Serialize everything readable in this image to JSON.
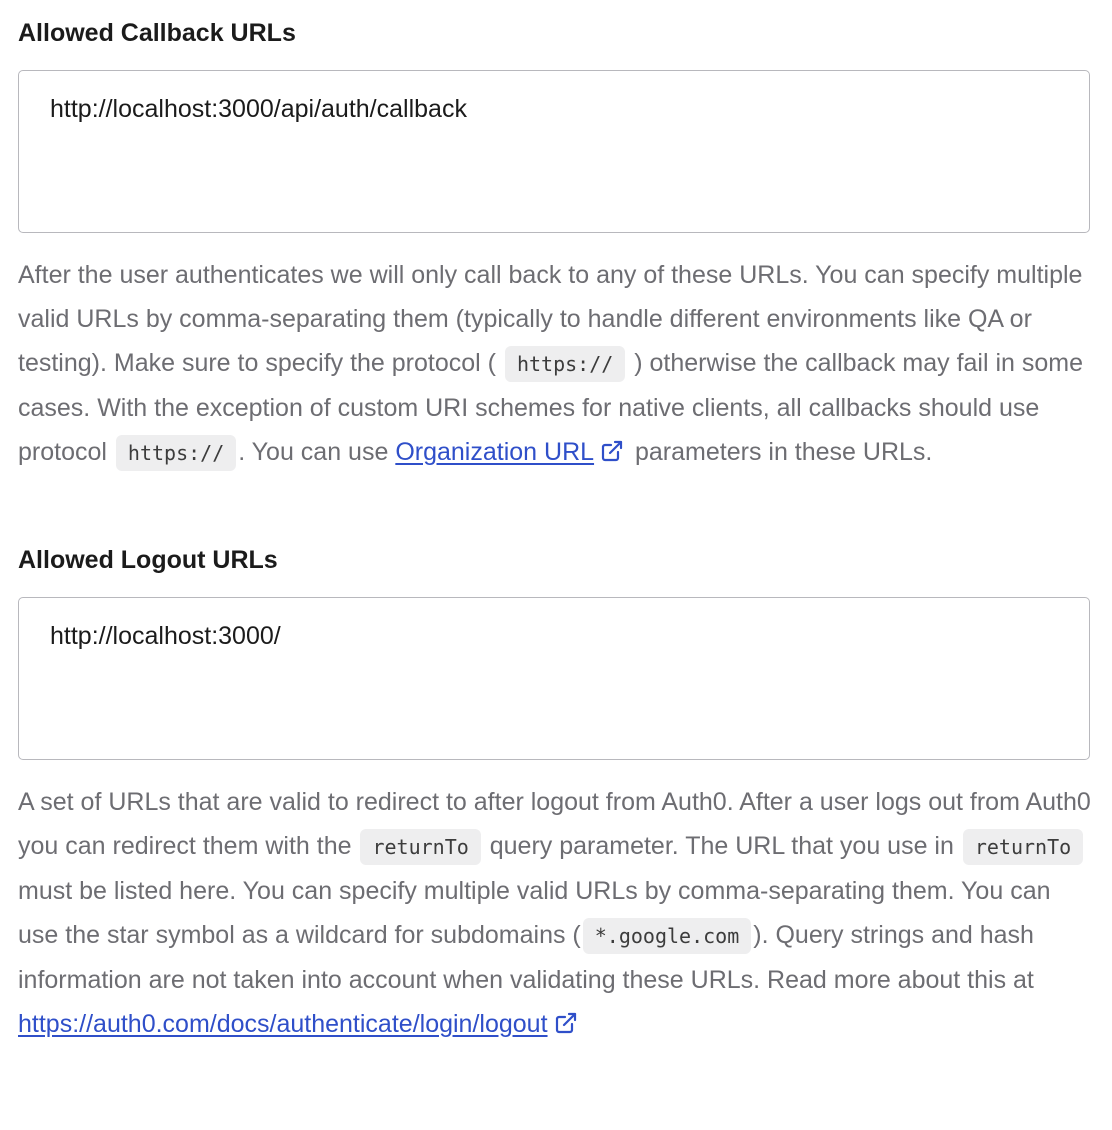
{
  "callback": {
    "label": "Allowed Callback URLs",
    "value": "http://localhost:3000/api/auth/callback",
    "help_1": "After the user authenticates we will only call back to any of these URLs. You can specify multiple valid URLs by comma-separating them (typically to handle different environments like QA or testing). Make sure to specify the protocol (",
    "code_1": "https://",
    "help_2": ") otherwise the callback may fail in some cases. With the exception of custom URI schemes for native clients, all callbacks should use protocol",
    "code_2": "https://",
    "help_3": ". You can use",
    "link_label": "Organization URL",
    "help_4": "parameters in these URLs."
  },
  "logout": {
    "label": "Allowed Logout URLs",
    "value": "http://localhost:3000/",
    "help_1": "A set of URLs that are valid to redirect to after logout from Auth0. After a user logs out from Auth0 you can redirect them with the",
    "code_1": "returnTo",
    "help_2": "query parameter. The URL that you use in",
    "code_2": "returnTo",
    "help_3": "must be listed here. You can specify multiple valid URLs by comma-separating them. You can use the star symbol as a wildcard for subdomains (",
    "code_3": "*.google.com",
    "help_4": "). Query strings and hash information are not taken into account when validating these URLs. Read more about this at",
    "link_label": "https://auth0.com/docs/authenticate/login/logout"
  },
  "colors": {
    "link": "#2f4fc9",
    "help_text": "#6d6d72",
    "border": "#b8b8bd"
  },
  "icons": {
    "external_link": "external-link-icon"
  }
}
